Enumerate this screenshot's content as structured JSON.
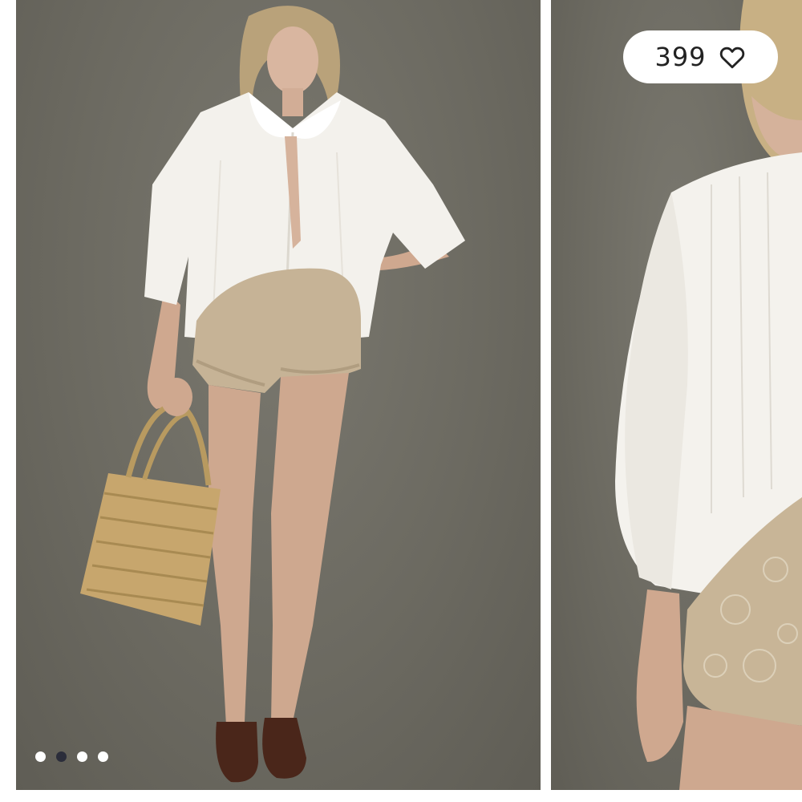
{
  "like": {
    "count": "399",
    "icon": "heart-outline-icon"
  },
  "carousel": {
    "slides": [
      {
        "label": "product-photo-front"
      },
      {
        "label": "product-photo-back"
      }
    ],
    "dots_total": 4,
    "active_dot": 2
  },
  "colors": {
    "backdrop": "#6f6d64",
    "pill": "#ffffff",
    "dot_active": "#2b2d3a",
    "dot_inactive": "#ffffff"
  }
}
